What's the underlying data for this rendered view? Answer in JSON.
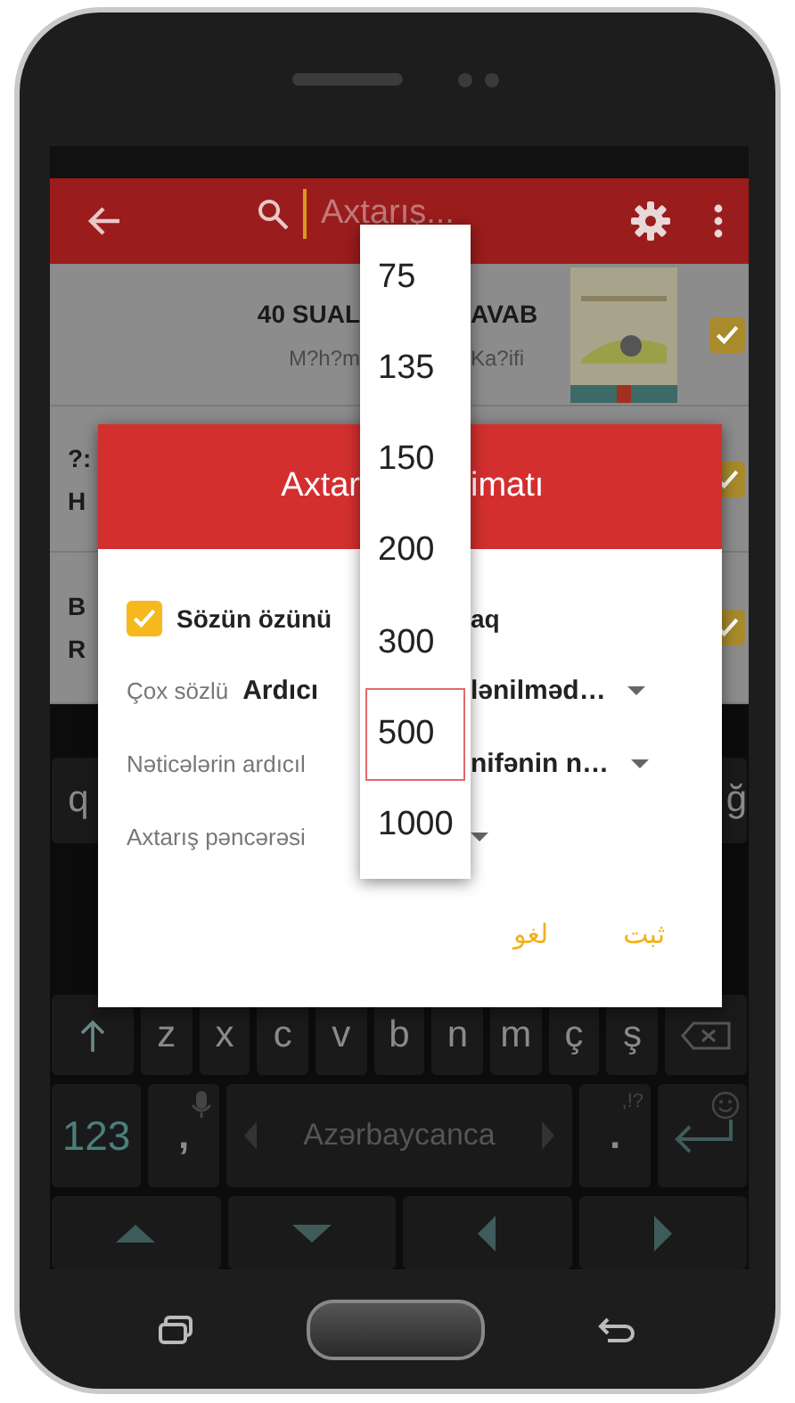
{
  "search": {
    "placeholder": "Axtarış..."
  },
  "results": [
    {
      "kind": "book",
      "title_start": "40 SUAL",
      "title_end": "AVAB",
      "subtitle_start": "M?h?m",
      "subtitle_end": "Ka?ifi",
      "checked": true
    },
    {
      "kind": "clipped",
      "lines": [
        "?:",
        "H"
      ],
      "checked": true
    },
    {
      "kind": "clipped",
      "lines": [
        "B",
        "R"
      ],
      "checked": true
    }
  ],
  "dialog": {
    "title_start": "Axtar",
    "title_end": "imatı",
    "option": {
      "label_start": "Sözün özünü",
      "label_end": "aq",
      "checked": true
    },
    "fields": [
      {
        "label": "Çox sözlü",
        "value_start": "Ardıcı",
        "value_end": "lənilməd…"
      },
      {
        "label": "Nəticələrin ardıcıl",
        "value_end": "nifənin n…"
      },
      {
        "label": "Axtarış pəncərəsi"
      }
    ],
    "buttons": [
      "ثبت",
      "لغو"
    ]
  },
  "dropdown": {
    "options": [
      {
        "label": "75",
        "selected": false
      },
      {
        "label": "135",
        "selected": false
      },
      {
        "label": "150",
        "selected": false
      },
      {
        "label": "200",
        "selected": false
      },
      {
        "label": "300",
        "selected": false
      },
      {
        "label": "500",
        "selected": true
      },
      {
        "label": "1000",
        "selected": false
      }
    ]
  },
  "keyboard": {
    "edge_keys": [
      "q",
      "ğ"
    ],
    "letter_keys": [
      "z",
      "x",
      "c",
      "v",
      "b",
      "n",
      "m",
      "ç",
      "ş"
    ],
    "number_key": "123",
    "comma_key": ",",
    "space_label": "Azərbaycanca",
    "period_key": ".",
    "period_hint": ",!?"
  }
}
